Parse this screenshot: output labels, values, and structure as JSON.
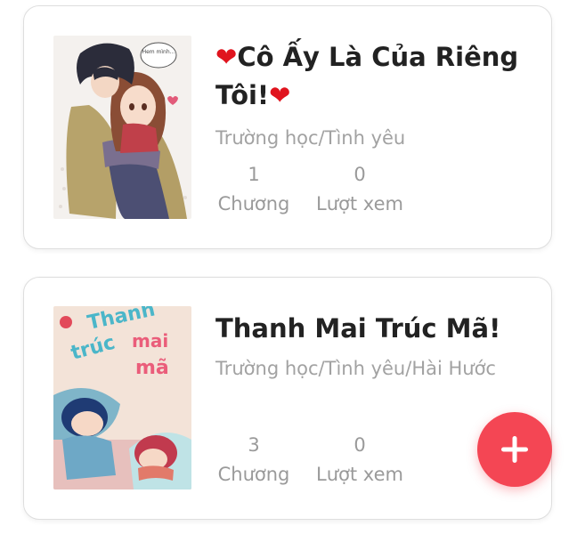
{
  "stories": [
    {
      "heart_left": "❤",
      "title_text": "Cô Ấy Là Của Riêng Tôi!",
      "heart_right": "❤",
      "genre": "Trường học/Tình yêu",
      "chapters": "1",
      "chapters_label": "Chương",
      "views": "0",
      "views_label": "Lượt xem",
      "cover_bubble": "Hem mình..."
    },
    {
      "title_text": "Thanh Mai Trúc Mã!",
      "genre": "Trường học/Tình yêu/Hài Hước",
      "chapters": "3",
      "chapters_label": "Chương",
      "views": "0",
      "views_label": "Lượt xem",
      "cover_text_1": "Thanh",
      "cover_text_2": "mai",
      "cover_text_3": "trúc",
      "cover_text_4": "mã"
    }
  ],
  "fab": {
    "icon": "plus-icon",
    "color": "#f44654"
  },
  "colors": {
    "heart": "#e0141e",
    "title": "#222222",
    "muted": "#a2a2a2"
  }
}
